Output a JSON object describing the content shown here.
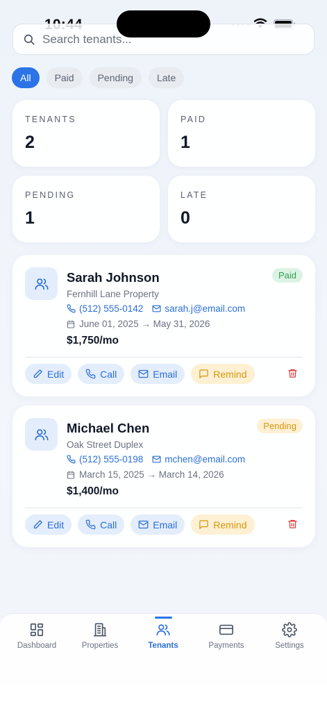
{
  "status_bar": {
    "time": "10:44"
  },
  "search": {
    "placeholder": "Search tenants..."
  },
  "filters": [
    {
      "label": "All",
      "active": true
    },
    {
      "label": "Paid",
      "active": false
    },
    {
      "label": "Pending",
      "active": false
    },
    {
      "label": "Late",
      "active": false
    }
  ],
  "stats": {
    "tenants": {
      "label": "TENANTS",
      "value": "2"
    },
    "paid": {
      "label": "PAID",
      "value": "1"
    },
    "pending": {
      "label": "PENDING",
      "value": "1"
    },
    "late": {
      "label": "LATE",
      "value": "0"
    }
  },
  "tenants": [
    {
      "name": "Sarah Johnson",
      "status": "Paid",
      "property": "Fernhill Lane Property",
      "phone": "(512) 555-0142",
      "email": "sarah.j@email.com",
      "lease": "June 01, 2025 → May 31, 2026",
      "rent": "$1,750/mo"
    },
    {
      "name": "Michael Chen",
      "status": "Pending",
      "property": "Oak Street Duplex",
      "phone": "(512) 555-0198",
      "email": "mchen@email.com",
      "lease": "March 15, 2025 → March 14, 2026",
      "rent": "$1,400/mo"
    }
  ],
  "actions": {
    "edit": "Edit",
    "call": "Call",
    "email": "Email",
    "remind": "Remind"
  },
  "tabs": [
    {
      "label": "Dashboard",
      "icon": "grid-icon"
    },
    {
      "label": "Properties",
      "icon": "building-icon"
    },
    {
      "label": "Tenants",
      "icon": "users-icon",
      "active": true
    },
    {
      "label": "Payments",
      "icon": "credit-card-icon"
    },
    {
      "label": "Settings",
      "icon": "gear-icon"
    }
  ],
  "colors": {
    "accent": "#2b73e6",
    "paid": "#2f9e55",
    "pending": "#d8960f",
    "delete": "#dc3b3b"
  }
}
